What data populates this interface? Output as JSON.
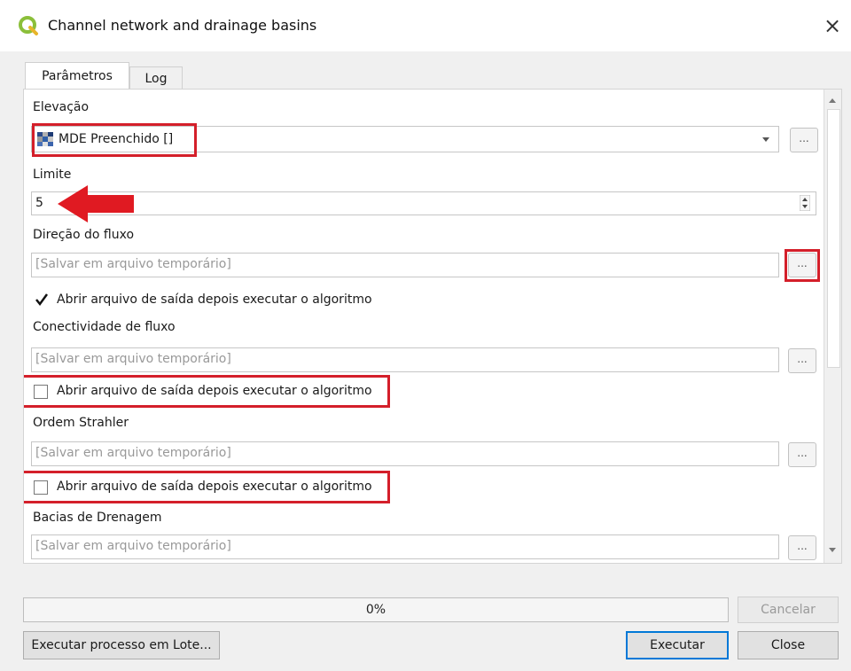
{
  "window": {
    "title": "Channel network and drainage basins",
    "close_label": "×"
  },
  "tabs": [
    {
      "label": "Parâmetros",
      "active": true
    },
    {
      "label": "Log",
      "active": false
    }
  ],
  "params": {
    "elevacao_label": "Elevação",
    "elevacao_value": "MDE Preenchido []",
    "limite_label": "Limite",
    "limite_value": "5",
    "direcao_label": "Direção do fluxo",
    "direcao_placeholder": "[Salvar em arquivo temporário]",
    "direcao_open_checked": true,
    "open_label_1": "Abrir arquivo de saída depois executar o algoritmo",
    "conectividade_label": "Conectividade de fluxo",
    "conectividade_placeholder": "[Salvar em arquivo temporário]",
    "open_label_2": "Abrir arquivo de saída depois executar o algoritmo",
    "strahler_label": "Ordem Strahler",
    "strahler_placeholder": "[Salvar em arquivo temporário]",
    "open_label_3": "Abrir arquivo de saída depois executar o algoritmo",
    "bacias_label": "Bacias de Drenagem",
    "bacias_placeholder": "[Salvar em arquivo temporário]",
    "browse_label": "..."
  },
  "progress": {
    "value": 0,
    "text": "0%"
  },
  "buttons": {
    "cancel": "Cancelar",
    "batch": "Executar processo em Lote...",
    "run": "Executar",
    "close": "Close"
  },
  "colors": {
    "highlight": "#d41f2a",
    "accent": "#0078d7"
  }
}
